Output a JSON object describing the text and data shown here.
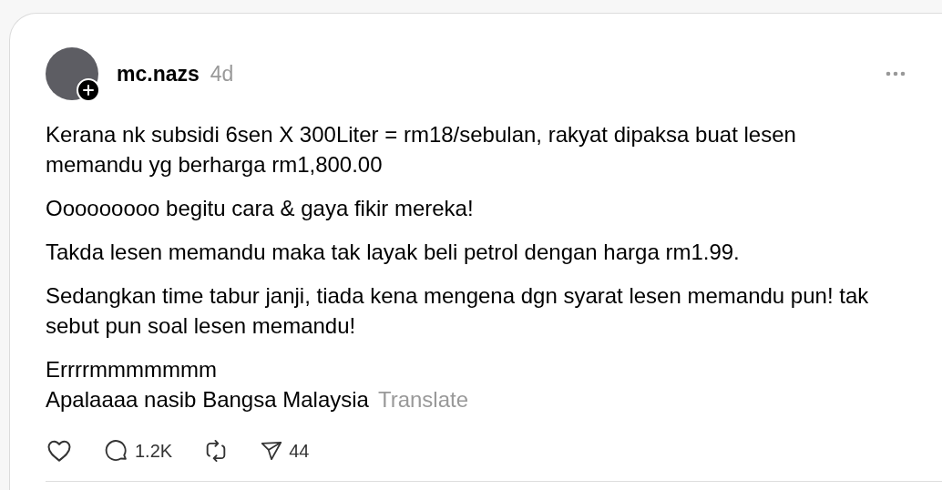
{
  "post": {
    "author": {
      "username": "mc.nazs",
      "time": "4d",
      "follow_badge": true
    },
    "paragraphs": [
      {
        "lines": [
          "Kerana nk subsidi 6sen X 300Liter = rm18/sebulan, rakyat dipaksa buat lesen memandu yg berharga rm1,800.00"
        ]
      },
      {
        "lines": [
          "Ooooooooo begitu cara & gaya fikir mereka!"
        ]
      },
      {
        "lines": [
          "Takda lesen memandu maka tak layak beli petrol dengan harga rm1.99."
        ]
      },
      {
        "lines": [
          "Sedangkan time tabur janji, tiada kena mengena dgn syarat lesen memandu pun! tak sebut pun soal lesen memandu!"
        ]
      },
      {
        "lines": [
          "Errrrmmmmmmm",
          "Apalaaaa nasib Bangsa Malaysia"
        ]
      }
    ],
    "translate_label": "Translate",
    "actions": [
      {
        "kind": "like"
      },
      {
        "kind": "reply",
        "count": "1.2K"
      },
      {
        "kind": "repost"
      },
      {
        "kind": "share",
        "count": "44"
      }
    ]
  }
}
